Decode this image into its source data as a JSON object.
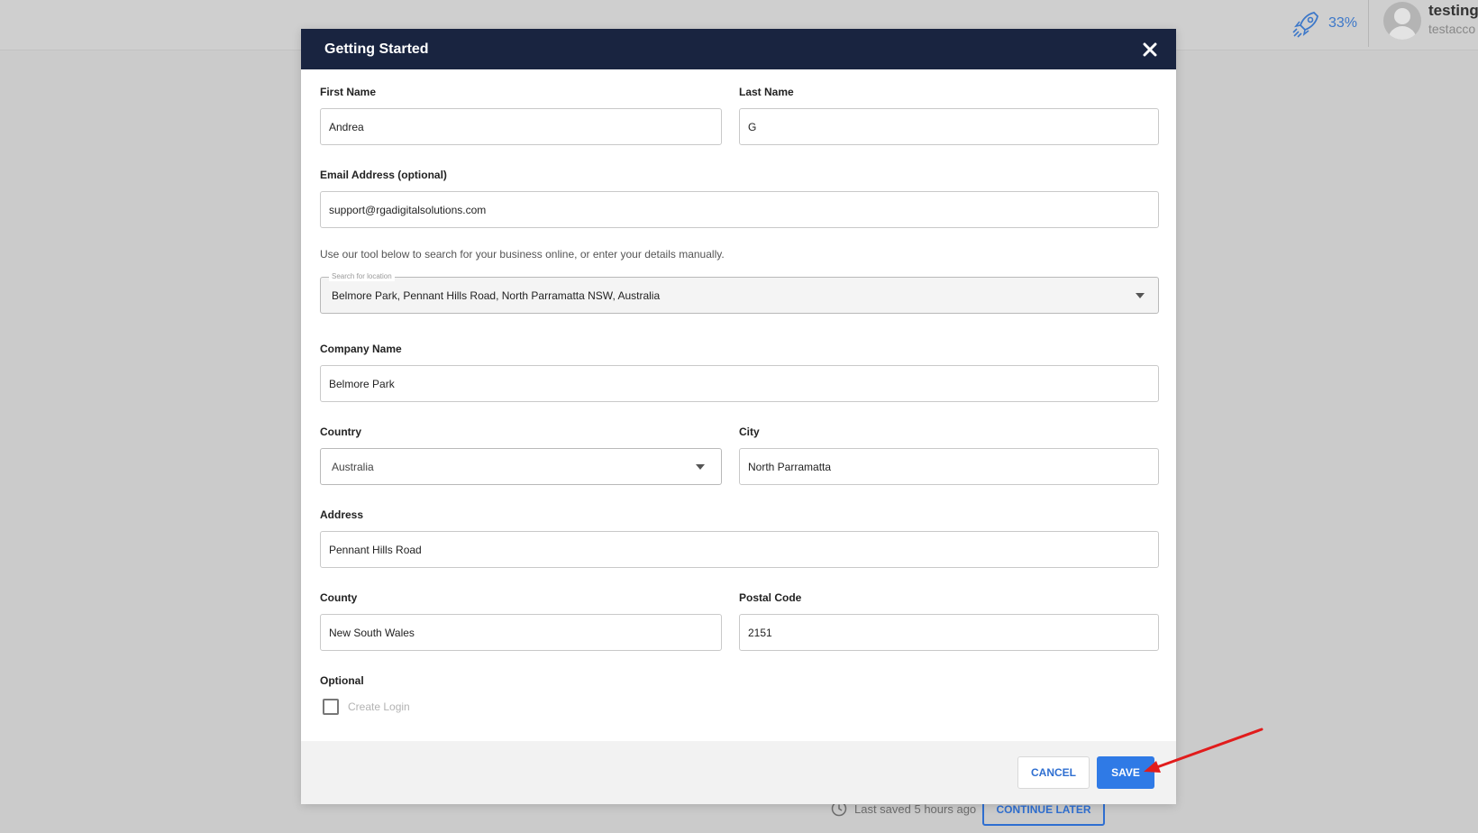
{
  "topbar": {
    "progress_text": "33%",
    "user_name": "testing",
    "user_sub": "testacco"
  },
  "background": {
    "last_saved": "Last saved 5 hours ago",
    "continue_later": "CONTINUE LATER"
  },
  "modal": {
    "title": "Getting Started",
    "first_name": {
      "label": "First Name",
      "value": "Andrea"
    },
    "last_name": {
      "label": "Last Name",
      "value": "G"
    },
    "email": {
      "label": "Email Address (optional)",
      "value": "support@rgadigitalsolutions.com"
    },
    "helper_text": "Use our tool below to search for your business online, or enter your details manually.",
    "location_search": {
      "legend": "Search for location",
      "value": "Belmore Park, Pennant Hills Road, North Parramatta NSW, Australia"
    },
    "company_name": {
      "label": "Company Name",
      "value": "Belmore Park"
    },
    "country": {
      "label": "Country",
      "value": "Australia"
    },
    "city": {
      "label": "City",
      "value": "North Parramatta"
    },
    "address": {
      "label": "Address",
      "value": "Pennant Hills Road"
    },
    "county": {
      "label": "County",
      "value": "New South Wales"
    },
    "postal_code": {
      "label": "Postal Code",
      "value": "2151"
    },
    "optional_label": "Optional",
    "create_login_label": "Create Login",
    "cancel_label": "CANCEL",
    "save_label": "SAVE"
  },
  "colors": {
    "header_bg": "#192440",
    "primary": "#2f7ae6",
    "annotation": "#e11c1c"
  },
  "icons": [
    "rocket-icon",
    "avatar-icon",
    "close-icon",
    "caret-down-icon",
    "clock-icon",
    "arrow-annotation"
  ]
}
